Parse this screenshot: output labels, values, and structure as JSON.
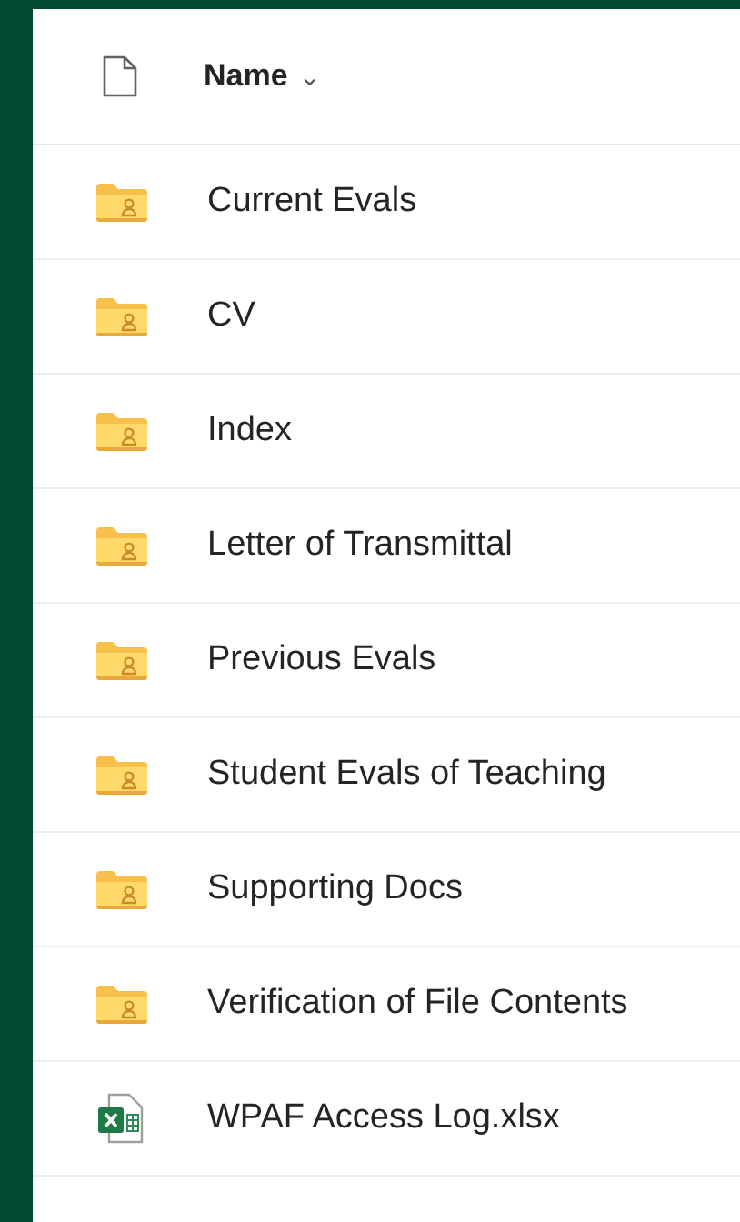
{
  "header": {
    "column": "Name",
    "sort_caret": "⌄"
  },
  "items": [
    {
      "name": "Current Evals",
      "kind": "shared-folder"
    },
    {
      "name": "CV",
      "kind": "shared-folder"
    },
    {
      "name": "Index",
      "kind": "shared-folder"
    },
    {
      "name": "Letter of Transmittal",
      "kind": "shared-folder"
    },
    {
      "name": "Previous Evals",
      "kind": "shared-folder"
    },
    {
      "name": "Student Evals of Teaching",
      "kind": "shared-folder"
    },
    {
      "name": "Supporting Docs",
      "kind": "shared-folder"
    },
    {
      "name": "Verification of File Contents",
      "kind": "shared-folder"
    },
    {
      "name": "WPAF Access Log.xlsx",
      "kind": "spreadsheet"
    }
  ]
}
